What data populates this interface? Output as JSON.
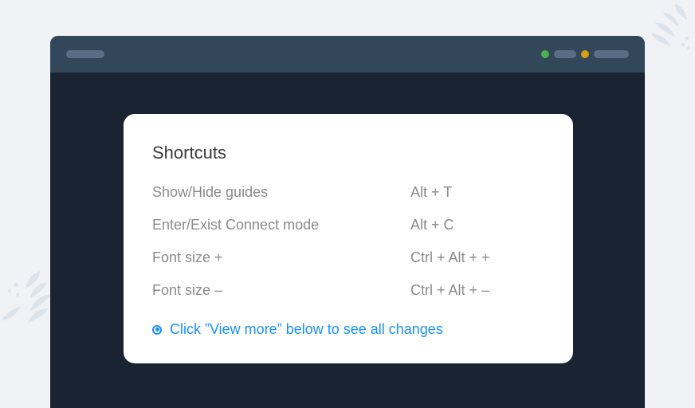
{
  "card": {
    "title": "Shortcuts"
  },
  "shortcuts": [
    {
      "label": "Show/Hide guides",
      "key": "Alt + T"
    },
    {
      "label": "Enter/Exist Connect mode",
      "key": "Alt + C"
    },
    {
      "label": "Font size +",
      "key": "Ctrl + Alt + +"
    },
    {
      "label": "Font size –",
      "key": "Ctrl + Alt + –"
    }
  ],
  "footer": {
    "text": "Click ”View more” below to see all changes"
  }
}
